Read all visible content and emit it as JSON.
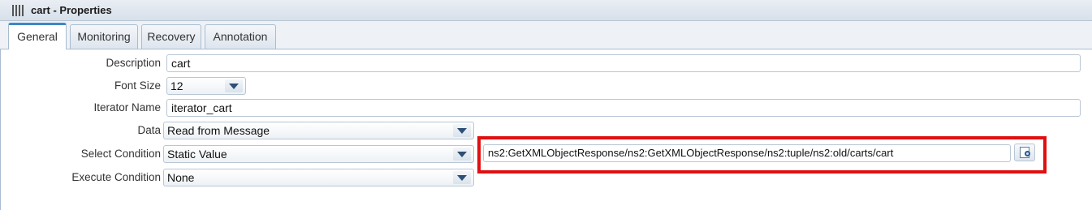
{
  "window": {
    "title": "cart - Properties"
  },
  "tabs": [
    {
      "label": "General",
      "active": true
    },
    {
      "label": "Monitoring",
      "active": false
    },
    {
      "label": "Recovery",
      "active": false
    },
    {
      "label": "Annotation",
      "active": false
    }
  ],
  "form": {
    "description": {
      "label": "Description",
      "value": "cart"
    },
    "font_size": {
      "label": "Font Size",
      "value": "12"
    },
    "iterator_name": {
      "label": "Iterator Name",
      "value": "iterator_cart"
    },
    "data": {
      "label": "Data",
      "value": "Read from Message"
    },
    "select_condition": {
      "label": "Select Condition",
      "value": "Static Value",
      "xpath": "ns2:GetXMLObjectResponse/ns2:GetXMLObjectResponse/ns2:tuple/ns2:old/carts/cart"
    },
    "execute_condition": {
      "label": "Execute Condition",
      "value": "None"
    }
  },
  "icons": {
    "window": "properties-grid-icon",
    "picker": "xpath-browse-icon"
  },
  "colors": {
    "active_tab_accent": "#3d87c9",
    "highlight": "#e01010"
  }
}
